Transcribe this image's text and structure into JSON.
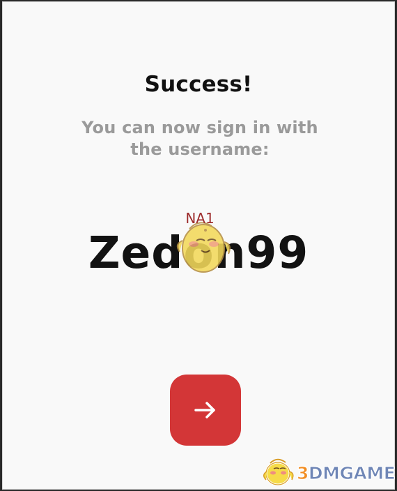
{
  "success": {
    "title": "Success!",
    "subtitle": "You can now sign in with the username:",
    "region_tag": "NA1",
    "username": "Zedon99"
  },
  "actions": {
    "next_icon": "arrow-right-icon",
    "accent_color": "#d33637"
  },
  "watermark": {
    "brand_prefix": "3",
    "brand_rest": "DMGAME"
  },
  "colors": {
    "background": "#f9f9f9",
    "title": "#111111",
    "subtitle": "#9a9a9a",
    "region_tag": "#9d2b2b"
  }
}
